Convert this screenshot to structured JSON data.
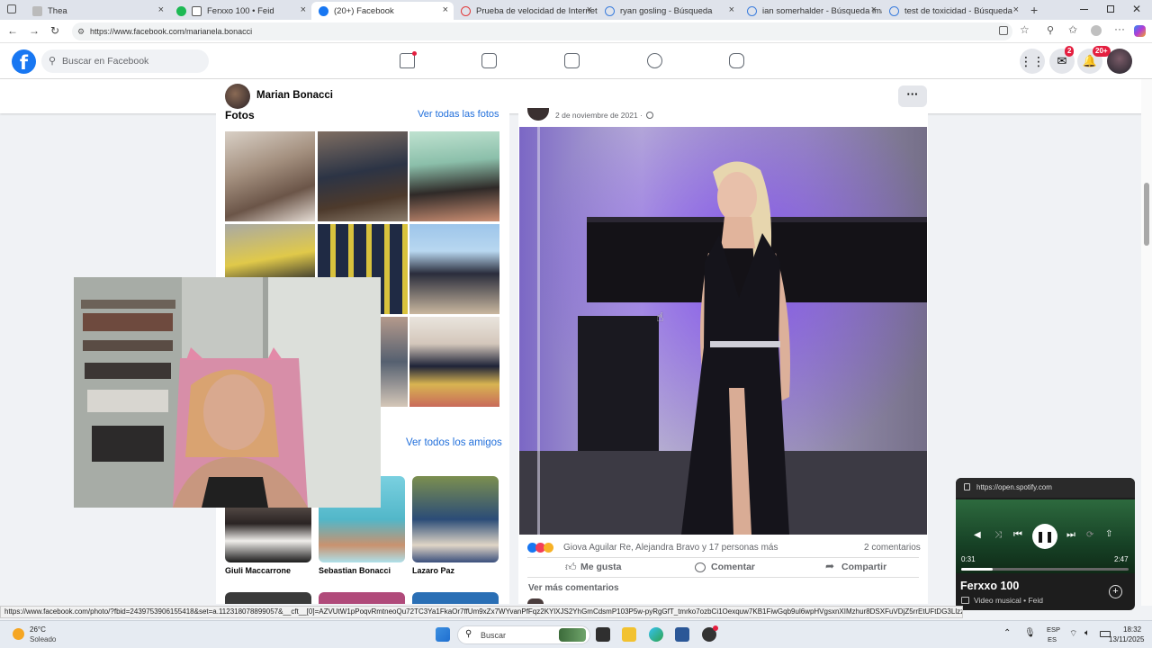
{
  "browser": {
    "tabs": [
      {
        "title": "Thea",
        "color": "#8a8a8a",
        "active": false
      },
      {
        "title": "Ferxxo 100 • Feid",
        "color": "#1db954",
        "active": false
      },
      {
        "title": "(20+) Facebook",
        "color": "#1877f2",
        "active": true
      },
      {
        "title": "Prueba de velocidad de Internet",
        "color": "#e23c3c",
        "active": false
      },
      {
        "title": "ryan gosling - Búsqueda",
        "color": "#3b7ddd",
        "active": false
      },
      {
        "title": "ian somerhalder - Búsqueda imá",
        "color": "#3b7ddd",
        "active": false
      },
      {
        "title": "test de toxicidad - Búsqueda",
        "color": "#3b7ddd",
        "active": false
      }
    ],
    "url": "https://www.facebook.com/marianela.bonacci",
    "new_tab": "+"
  },
  "facebook": {
    "logo": "f",
    "search_placeholder": "Buscar en Facebook",
    "messenger_badge": "2",
    "notifications_badge": "20+",
    "brand_color": "#1877f2"
  },
  "profile": {
    "name": "Marian Bonacci",
    "more_label": "···"
  },
  "left": {
    "photos_title": "Fotos",
    "photos_link": "Ver todas las fotos",
    "friends_link": "Ver todos los amigos",
    "friends": [
      {
        "name": "Giuli Maccarrone"
      },
      {
        "name": "Sebastian Bonacci"
      },
      {
        "name": "Lazaro Paz"
      }
    ]
  },
  "post": {
    "date": "2 de noviembre de 2021 ·",
    "reactions_text": "Giova Aguilar Re, Alejandra Bravo y 17 personas más",
    "comments_count": "2 comentarios",
    "like_label": "Me gusta",
    "comment_label": "Comentar",
    "share_label": "Compartir",
    "more_comments": "Ver más comentarios"
  },
  "spotify": {
    "url": "https://open.spotify.com",
    "time_current": "0:31",
    "time_total": "2:47",
    "progress": 0.19,
    "title": "Ferxxo 100",
    "subtitle": "Video musical • Feid"
  },
  "status_url": "https://www.facebook.com/photo/?fbid=2439753906155418&set=a.112318078899057&__cft__[0]=AZVUtW1pPoqvRmtneoQu72TC3Ya1FkaOr7ffUm9xZx7WYvanPfFqz2KYlXJS2YhGmCdsmP103P5w-pyRgGfT_tmrko7ozbCi1Oexquw7KB1FiwGqb9ul6wpHVgsxnXIMzhur8DSXFuVDjZ5rrEtUFtDG3LlzzFZ",
  "taskbar": {
    "temperature": "26°C",
    "weather": "Soleado",
    "search_label": "Buscar",
    "lang_top": "ESP",
    "lang_bottom": "ES",
    "time": "18:32",
    "date": "13/11/2025"
  }
}
